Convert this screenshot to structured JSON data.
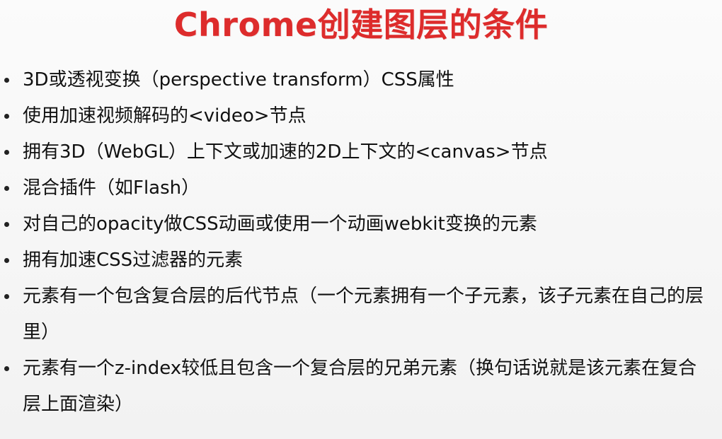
{
  "title": "Chrome创建图层的条件",
  "bullets": [
    "3D或透视变换（perspective transform）CSS属性",
    "使用加速视频解码的<video>节点",
    "拥有3D（WebGL）上下文或加速的2D上下文的<canvas>节点",
    "混合插件（如Flash）",
    "对自己的opacity做CSS动画或使用一个动画webkit变换的元素",
    "拥有加速CSS过滤器的元素",
    "元素有一个包含复合层的后代节点（一个元素拥有一个子元素，该子元素在自己的层里）",
    "元素有一个z-index较低且包含一个复合层的兄弟元素（换句话说就是该元素在复合层上面渲染）"
  ],
  "colors": {
    "title": "#dd2c2c",
    "text": "#111111",
    "background": "#f7f7f7"
  }
}
